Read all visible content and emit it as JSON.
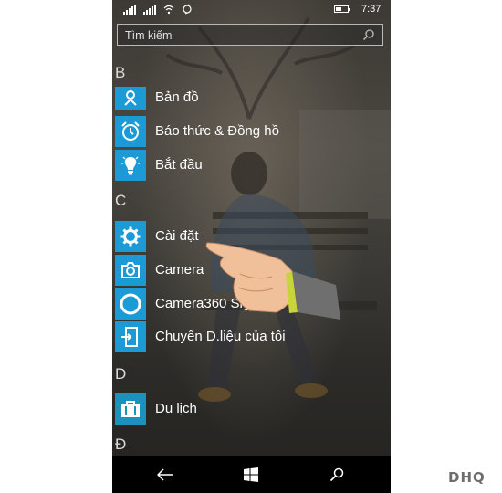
{
  "status": {
    "time": "7:37"
  },
  "search": {
    "placeholder": "Tìm kiếm"
  },
  "sections": [
    {
      "letter": "B",
      "apps": [
        {
          "label": "Bản đồ",
          "icon": "map-icon"
        },
        {
          "label": "Báo thức & Đồng hồ",
          "icon": "alarm-clock-icon"
        },
        {
          "label": "Bắt đầu",
          "icon": "lightbulb-icon"
        }
      ]
    },
    {
      "letter": "C",
      "apps": [
        {
          "label": "Cài đặt",
          "icon": "gear-icon"
        },
        {
          "label": "Camera",
          "icon": "camera-icon"
        },
        {
          "label": "Camera360 Sight",
          "icon": "camera360-icon"
        },
        {
          "label": "Chuyển D.liệu của tôi",
          "icon": "transfer-icon"
        }
      ]
    },
    {
      "letter": "D",
      "apps": [
        {
          "label": "Du lịch",
          "icon": "suitcase-icon"
        }
      ]
    },
    {
      "letter": "Đ",
      "apps": []
    }
  ],
  "navbar": {
    "icons": [
      "back-icon",
      "windows-icon",
      "search-icon"
    ]
  },
  "watermark": "DHQ",
  "colors": {
    "tile": "#1b9ad6",
    "navbar": "#000000"
  }
}
